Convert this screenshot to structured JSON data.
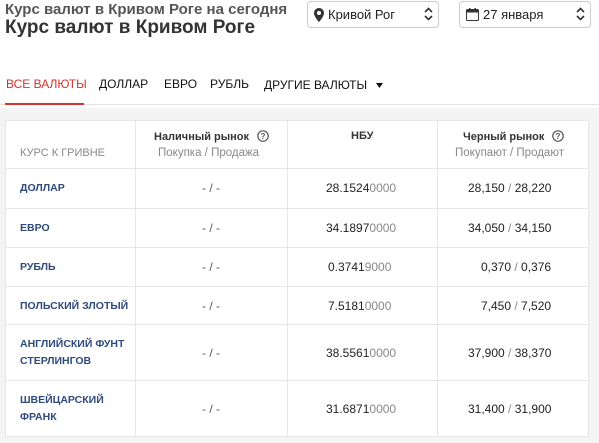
{
  "header": {
    "title_small": "Курс валют в Кривом Роге на сегодня",
    "title": "Курс валют в Кривом Роге",
    "city_select": "Кривой Рог",
    "date_select": "27 января"
  },
  "tabs": [
    {
      "label": "ВСЕ ВАЛЮТЫ",
      "active": true
    },
    {
      "label": "ДОЛЛАР"
    },
    {
      "label": "ЕВРО"
    },
    {
      "label": "РУБЛЬ"
    },
    {
      "label": "ДРУГИЕ ВАЛЮТЫ"
    }
  ],
  "table": {
    "col_currency": "КУРС К ГРИВНЕ",
    "col_cash": "Наличный рынок",
    "col_cash_sub": "Покупка / Продажа",
    "col_nbu": "НБУ",
    "col_black": "Черный рынок",
    "col_black_sub": "Покупают / Продают",
    "rows": [
      {
        "currency": "ДОЛЛАР",
        "cash": "- / -",
        "nbu_main": "28.1524",
        "nbu_tail": "0000",
        "black_buy": "28,150",
        "black_sep": " / ",
        "black_sell": "28,220"
      },
      {
        "currency": "ЕВРО",
        "cash": "- / -",
        "nbu_main": "34.1897",
        "nbu_tail": "0000",
        "black_buy": "34,050",
        "black_sep": " / ",
        "black_sell": "34,150"
      },
      {
        "currency": "РУБЛЬ",
        "cash": "- / -",
        "nbu_main": "0.3741",
        "nbu_tail": "9000",
        "black_buy": "0,370",
        "black_sep": " / ",
        "black_sell": "0,376"
      },
      {
        "currency": "ПОЛЬСКИЙ ЗЛОТЫЙ",
        "cash": "- / -",
        "nbu_main": "7.5181",
        "nbu_tail": "0000",
        "black_buy": "7,450",
        "black_sep": " / ",
        "black_sell": "7,520"
      },
      {
        "currency": "АНГЛИЙСКИЙ ФУНТ СТЕРЛИНГОВ",
        "cash": "- / -",
        "nbu_main": "38.5561",
        "nbu_tail": "0000",
        "black_buy": "37,900",
        "black_sep": " / ",
        "black_sell": "38,370"
      },
      {
        "currency": "ШВЕЙЦАРСКИЙ ФРАНК",
        "cash": "- / -",
        "nbu_main": "31.6871",
        "nbu_tail": "0000",
        "black_buy": "31,400",
        "black_sep": " / ",
        "black_sell": "31,900"
      }
    ]
  },
  "icons": {
    "city": "map-pin-icon",
    "date": "calendar-icon",
    "help": "help-circle-icon",
    "dropdown": "caret-down-icon"
  },
  "colors": {
    "accent": "#d6322c",
    "currency_link": "#2f4a7c"
  }
}
